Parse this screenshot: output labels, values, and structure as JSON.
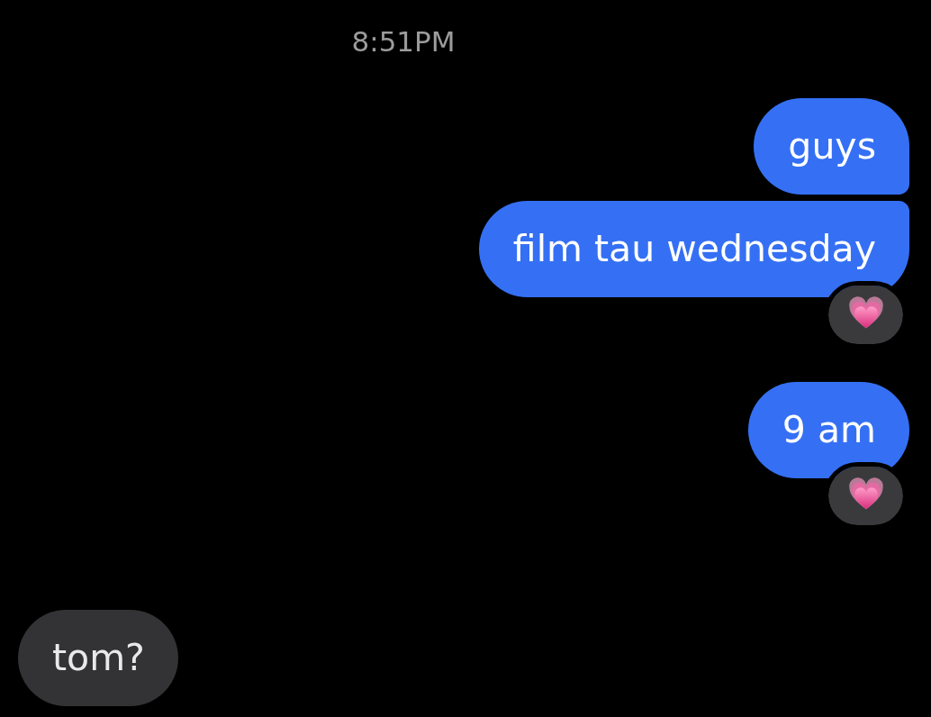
{
  "timestamp": "8:51PM",
  "messages": [
    {
      "kind": "sent",
      "text": "guys",
      "hearted": false
    },
    {
      "kind": "sent",
      "text": "film tau wednesday",
      "hearted": true
    },
    {
      "kind": "sent",
      "text": "9 am",
      "hearted": true
    },
    {
      "kind": "received",
      "text": "tom?",
      "hearted": false
    }
  ]
}
